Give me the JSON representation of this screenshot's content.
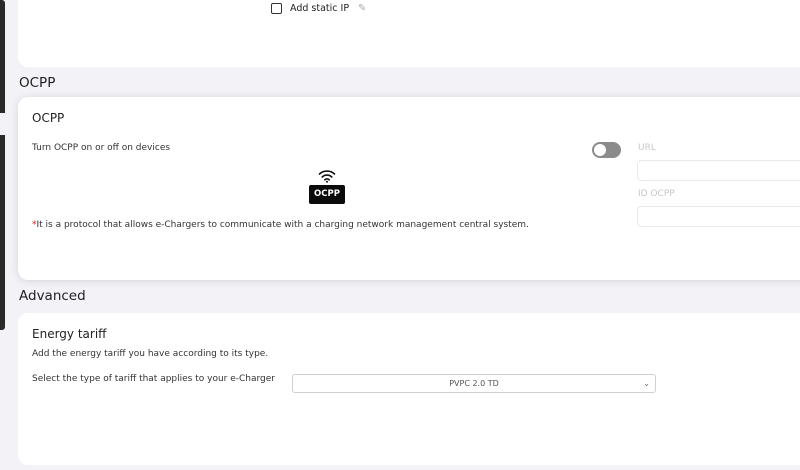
{
  "network": {
    "static_ip_label": "Add static IP"
  },
  "sections": {
    "ocpp_heading": "OCPP",
    "advanced_heading": "Advanced"
  },
  "ocpp_card": {
    "title": "OCPP",
    "toggle_label": "Turn OCPP on or off on devices",
    "toggle_on": false,
    "logo_text": "OCPP",
    "note_asterisk": "*",
    "note_text": "It is a protocol that allows e-Chargers to communicate with a charging network management central system.",
    "url_label": "URL",
    "url_value": "",
    "id_label": "ID OCPP",
    "id_value": ""
  },
  "energy_tariff": {
    "title": "Energy tariff",
    "description": "Add the energy tariff you have according to its type.",
    "select_label": "Select the type of tariff that applies to your e-Charger",
    "selected_value": "PVPC 2.0 TD"
  },
  "colors": {
    "page_bg": "#f3f2f6",
    "card_bg": "#ffffff",
    "toggle_off": "#8b8b8b",
    "asterisk": "#d42020"
  },
  "icons": [
    "checkbox-icon",
    "pencil-icon",
    "wifi-icon",
    "chevron-down-icon"
  ]
}
